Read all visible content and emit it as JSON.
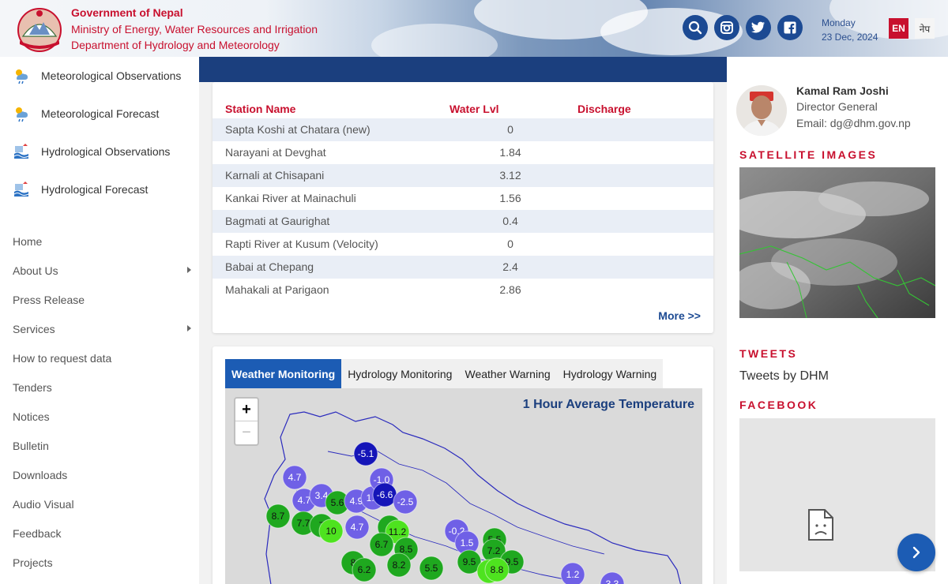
{
  "header": {
    "org_line1": "Government of Nepal",
    "org_line2": "Ministry of Energy, Water Resources and Irrigation",
    "org_line3": "Department of Hydrology and Meteorology",
    "date_day": "Monday",
    "date_full": "23 Dec, 2024",
    "lang_en": "EN",
    "lang_ne": "नेप",
    "social_icons": [
      "search-icon",
      "instagram-icon",
      "twitter-icon",
      "facebook-icon"
    ]
  },
  "sidebar": {
    "quick_links": [
      {
        "label": "Meteorological Observations",
        "icon": "weather-icon"
      },
      {
        "label": "Meteorological Forecast",
        "icon": "weather-icon"
      },
      {
        "label": "Hydrological Observations",
        "icon": "flood-icon"
      },
      {
        "label": "Hydrological Forecast",
        "icon": "flood-icon"
      }
    ],
    "menu": [
      {
        "label": "Home"
      },
      {
        "label": "About Us"
      },
      {
        "label": "Press Release"
      },
      {
        "label": "Services"
      },
      {
        "label": "How to request data"
      },
      {
        "label": "Tenders"
      },
      {
        "label": "Notices"
      },
      {
        "label": "Bulletin"
      },
      {
        "label": "Downloads"
      },
      {
        "label": "Audio Visual"
      },
      {
        "label": "Feedback"
      },
      {
        "label": "Projects"
      }
    ]
  },
  "table": {
    "headers": [
      "Station Name",
      "Water Lvl",
      "Discharge"
    ],
    "rows": [
      {
        "name": "Sapta Koshi at Chatara (new)",
        "level": "0"
      },
      {
        "name": "Narayani at Devghat",
        "level": "1.84"
      },
      {
        "name": "Karnali at Chisapani",
        "level": "3.12"
      },
      {
        "name": "Kankai River at Mainachuli",
        "level": "1.56"
      },
      {
        "name": "Bagmati at Gaurighat",
        "level": "0.4"
      },
      {
        "name": "Rapti River at Kusum (Velocity)",
        "level": "0"
      },
      {
        "name": "Babai at Chepang",
        "level": "2.4"
      },
      {
        "name": "Mahakali at Parigaon",
        "level": "2.86"
      }
    ],
    "more": "More >>"
  },
  "monitor": {
    "tabs": [
      "Weather Monitoring",
      "Hydrology Monitoring",
      "Weather Warning",
      "Hydrology Warning"
    ],
    "active_tab": 0,
    "map_title": "1 Hour Average Temperature",
    "zoom_in": "+",
    "zoom_out": "−",
    "stations": [
      {
        "v": "-5.1",
        "c": "#1515b8"
      },
      {
        "v": "4.7",
        "c": "#6f60e6"
      },
      {
        "v": "4.7",
        "c": "#6f60e6"
      },
      {
        "v": "3.4",
        "c": "#6f60e6"
      },
      {
        "v": "5.6",
        "c": "#1fa81f"
      },
      {
        "v": "4.9",
        "c": "#6f60e6"
      },
      {
        "v": "1.7",
        "c": "#6f60e6"
      },
      {
        "v": "-1.0",
        "c": "#6f60e6"
      },
      {
        "v": "-6.6",
        "c": "#1515b8"
      },
      {
        "v": "-2.5",
        "c": "#6f60e6"
      },
      {
        "v": "8.7",
        "c": "#1fa81f"
      },
      {
        "v": "7.7",
        "c": "#1fa81f"
      },
      {
        "v": "7",
        "c": "#1fa81f"
      },
      {
        "v": "10",
        "c": "#4ee31f"
      },
      {
        "v": "4.7",
        "c": "#6f60e6"
      },
      {
        "v": "6",
        "c": "#1fa81f"
      },
      {
        "v": "11.2",
        "c": "#4ee31f"
      },
      {
        "v": "6.7",
        "c": "#1fa81f"
      },
      {
        "v": "8.5",
        "c": "#1fa81f"
      },
      {
        "v": "-0.2",
        "c": "#6f60e6"
      },
      {
        "v": "1.5",
        "c": "#6f60e6"
      },
      {
        "v": "5.5",
        "c": "#1fa81f"
      },
      {
        "v": "7.2",
        "c": "#1fa81f"
      },
      {
        "v": "9.5",
        "c": "#1fa81f"
      },
      {
        "v": "9.5",
        "c": "#1fa81f"
      },
      {
        "v": "8",
        "c": "#1fa81f"
      },
      {
        "v": "6.2",
        "c": "#1fa81f"
      },
      {
        "v": "8.2",
        "c": "#1fa81f"
      },
      {
        "v": "5.5",
        "c": "#1fa81f"
      },
      {
        "v": "1",
        "c": "#4ee31f"
      },
      {
        "v": "8.8",
        "c": "#4ee31f"
      },
      {
        "v": "1.2",
        "c": "#6f60e6"
      },
      {
        "v": "3.3",
        "c": "#6f60e6"
      }
    ]
  },
  "right": {
    "dg_name": "Kamal Ram Joshi",
    "dg_title": "Director General",
    "dg_email": "Email: dg@dhm.gov.np",
    "satellite_title": "SATELLITE IMAGES",
    "tweets_title": "TWEETS",
    "tweets_by": "Tweets by DHM",
    "facebook_title": "FACEBOOK"
  },
  "colors": {
    "brand_red": "#c8102e",
    "brand_blue": "#1b3f7e",
    "accent_blue": "#1c5cb4"
  }
}
